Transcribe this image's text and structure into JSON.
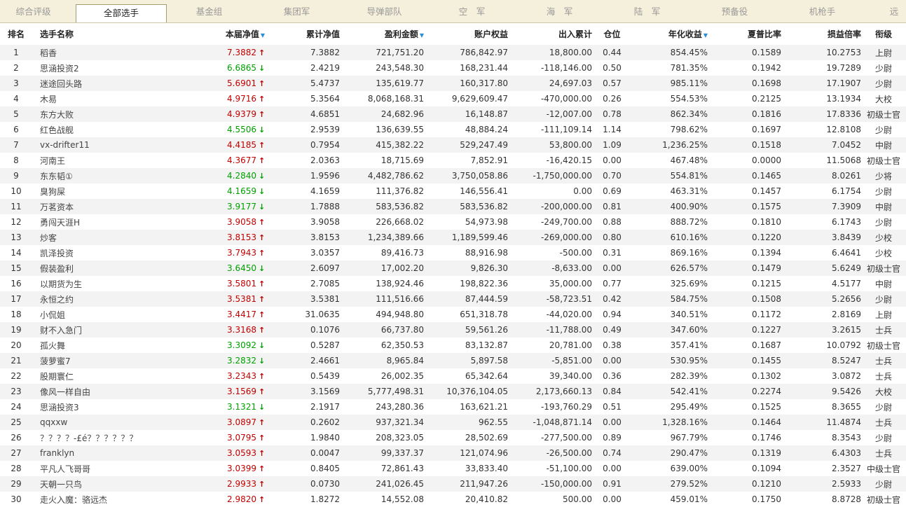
{
  "tabs": [
    "综合评级",
    "全部选手",
    "基金组",
    "集团军",
    "导弹部队",
    "空　军",
    "海　军",
    "陆　军",
    "预备役",
    "机枪手",
    "远"
  ],
  "active_tab": 1,
  "headers": [
    "排名",
    "选手名称",
    "本届净值",
    "累计净值",
    "盈利金额",
    "账户权益",
    "出入累计",
    "仓位",
    "年化收益",
    "夏普比率",
    "损益倍率",
    "衔级"
  ],
  "rows": [
    [
      "1",
      "稻香",
      "7.3882",
      "up",
      "7.3882",
      "721,751.20",
      "786,842.97",
      "18,800.00",
      "0.44",
      "854.45%",
      "0.1589",
      "10.2753",
      "上尉"
    ],
    [
      "2",
      "思涵投资2",
      "6.6865",
      "down",
      "2.4219",
      "243,548.30",
      "168,231.44",
      "-118,146.00",
      "0.50",
      "781.35%",
      "0.1942",
      "19.7289",
      "少尉"
    ],
    [
      "3",
      "迷途回头路",
      "5.6901",
      "up",
      "5.4737",
      "135,619.77",
      "160,317.80",
      "24,697.03",
      "0.57",
      "985.11%",
      "0.1698",
      "17.1907",
      "少尉"
    ],
    [
      "4",
      "木易",
      "4.9716",
      "up",
      "5.3564",
      "8,068,168.31",
      "9,629,609.47",
      "-470,000.00",
      "0.26",
      "554.53%",
      "0.2125",
      "13.1934",
      "大校"
    ],
    [
      "5",
      "东方大败",
      "4.9379",
      "up",
      "4.6851",
      "24,682.96",
      "16,148.87",
      "-12,007.00",
      "0.78",
      "862.34%",
      "0.1816",
      "17.8336",
      "初级士官"
    ],
    [
      "6",
      "红色战舰",
      "4.5506",
      "down",
      "2.9539",
      "136,639.55",
      "48,884.24",
      "-111,109.14",
      "1.14",
      "798.62%",
      "0.1697",
      "12.8108",
      "少尉"
    ],
    [
      "7",
      "vx-drifter11",
      "4.4185",
      "up",
      "0.7954",
      "415,382.22",
      "529,247.49",
      "53,800.00",
      "1.09",
      "1,236.25%",
      "0.1518",
      "7.0452",
      "中尉"
    ],
    [
      "8",
      "河南王",
      "4.3677",
      "up",
      "2.0363",
      "18,715.69",
      "7,852.91",
      "-16,420.15",
      "0.00",
      "467.48%",
      "0.0000",
      "11.5068",
      "初级士官"
    ],
    [
      "9",
      "东东韬①",
      "4.2840",
      "down",
      "1.9596",
      "4,482,786.62",
      "3,750,058.86",
      "-1,750,000.00",
      "0.70",
      "554.81%",
      "0.1465",
      "8.0261",
      "少将"
    ],
    [
      "10",
      "臭狗屎",
      "4.1659",
      "down",
      "4.1659",
      "111,376.82",
      "146,556.41",
      "0.00",
      "0.69",
      "463.31%",
      "0.1457",
      "6.1754",
      "少尉"
    ],
    [
      "11",
      "万茗资本",
      "3.9177",
      "down",
      "1.7888",
      "583,536.82",
      "583,536.82",
      "-200,000.00",
      "0.81",
      "400.90%",
      "0.1575",
      "7.3909",
      "中尉"
    ],
    [
      "12",
      "勇闯天涯H",
      "3.9058",
      "up",
      "3.9058",
      "226,668.02",
      "54,973.98",
      "-249,700.00",
      "0.88",
      "888.72%",
      "0.1810",
      "6.1743",
      "少尉"
    ],
    [
      "13",
      "炒客",
      "3.8153",
      "up",
      "3.8153",
      "1,234,389.66",
      "1,189,599.46",
      "-269,000.00",
      "0.80",
      "610.16%",
      "0.1220",
      "3.8439",
      "少校"
    ],
    [
      "14",
      "凯泽投资",
      "3.7943",
      "up",
      "3.0357",
      "89,416.73",
      "88,916.98",
      "-500.00",
      "0.31",
      "869.16%",
      "0.1394",
      "6.4641",
      "少校"
    ],
    [
      "15",
      "假装盈利",
      "3.6450",
      "down",
      "2.6097",
      "17,002.20",
      "9,826.30",
      "-8,633.00",
      "0.00",
      "626.57%",
      "0.1479",
      "5.6249",
      "初级士官"
    ],
    [
      "16",
      "以期货为生",
      "3.5801",
      "up",
      "2.7085",
      "138,924.46",
      "198,822.36",
      "35,000.00",
      "0.77",
      "325.69%",
      "0.1215",
      "4.5177",
      "中尉"
    ],
    [
      "17",
      "永恒之约",
      "3.5381",
      "up",
      "3.5381",
      "111,516.66",
      "87,444.59",
      "-58,723.51",
      "0.42",
      "584.75%",
      "0.1508",
      "5.2656",
      "少尉"
    ],
    [
      "18",
      "小侃姐",
      "3.4417",
      "up",
      "31.0635",
      "494,948.80",
      "651,318.78",
      "-44,020.00",
      "0.94",
      "340.51%",
      "0.1172",
      "2.8169",
      "上尉"
    ],
    [
      "19",
      "财不入急门",
      "3.3168",
      "up",
      "0.1076",
      "66,737.80",
      "59,561.26",
      "-11,788.00",
      "0.49",
      "347.60%",
      "0.1227",
      "3.2615",
      "士兵"
    ],
    [
      "20",
      "孤火舞",
      "3.3092",
      "down",
      "0.5287",
      "62,350.53",
      "83,132.87",
      "20,781.00",
      "0.38",
      "357.41%",
      "0.1687",
      "10.0792",
      "初级士官"
    ],
    [
      "21",
      "菠萝蜜7",
      "3.2832",
      "down",
      "2.4661",
      "8,965.84",
      "5,897.58",
      "-5,851.00",
      "0.00",
      "530.95%",
      "0.1455",
      "8.5247",
      "士兵"
    ],
    [
      "22",
      "股期寰仁",
      "3.2343",
      "up",
      "0.5439",
      "26,002.35",
      "65,342.64",
      "39,340.00",
      "0.36",
      "282.39%",
      "0.1302",
      "3.0872",
      "士兵"
    ],
    [
      "23",
      "像风一样自由",
      "3.1569",
      "up",
      "3.1569",
      "5,777,498.31",
      "10,376,104.05",
      "2,173,660.13",
      "0.84",
      "542.41%",
      "0.2274",
      "9.5426",
      "大校"
    ],
    [
      "24",
      "思涵投资3",
      "3.1321",
      "down",
      "2.1917",
      "243,280.36",
      "163,621.21",
      "-193,760.29",
      "0.51",
      "295.49%",
      "0.1525",
      "8.3655",
      "少尉"
    ],
    [
      "25",
      "qqxxw",
      "3.0897",
      "up",
      "0.2602",
      "937,321.34",
      "962.55",
      "-1,048,871.14",
      "0.00",
      "1,328.16%",
      "0.1464",
      "11.4874",
      "士兵"
    ],
    [
      "26",
      "？？？？-£é？？？？？？2",
      "3.0795",
      "up",
      "1.9840",
      "208,323.05",
      "28,502.69",
      "-277,500.00",
      "0.89",
      "967.79%",
      "0.1746",
      "8.3543",
      "少尉"
    ],
    [
      "27",
      "franklyn",
      "3.0593",
      "up",
      "0.0047",
      "99,337.37",
      "121,074.96",
      "-26,500.00",
      "0.74",
      "290.47%",
      "0.1319",
      "6.4303",
      "士兵"
    ],
    [
      "28",
      "平凡人飞哥哥",
      "3.0399",
      "up",
      "0.8405",
      "72,861.43",
      "33,833.40",
      "-51,100.00",
      "0.00",
      "639.00%",
      "0.1094",
      "2.3527",
      "中级士官"
    ],
    [
      "29",
      "天朝一只鸟",
      "2.9933",
      "up",
      "0.0730",
      "241,026.45",
      "211,947.26",
      "-150,000.00",
      "0.91",
      "279.52%",
      "0.1210",
      "2.5933",
      "少尉"
    ],
    [
      "30",
      "走火入魔：骆远杰",
      "2.9820",
      "up",
      "1.8272",
      "14,552.08",
      "20,410.82",
      "500.00",
      "0.00",
      "459.01%",
      "0.1750",
      "8.8728",
      "初级士官"
    ]
  ]
}
